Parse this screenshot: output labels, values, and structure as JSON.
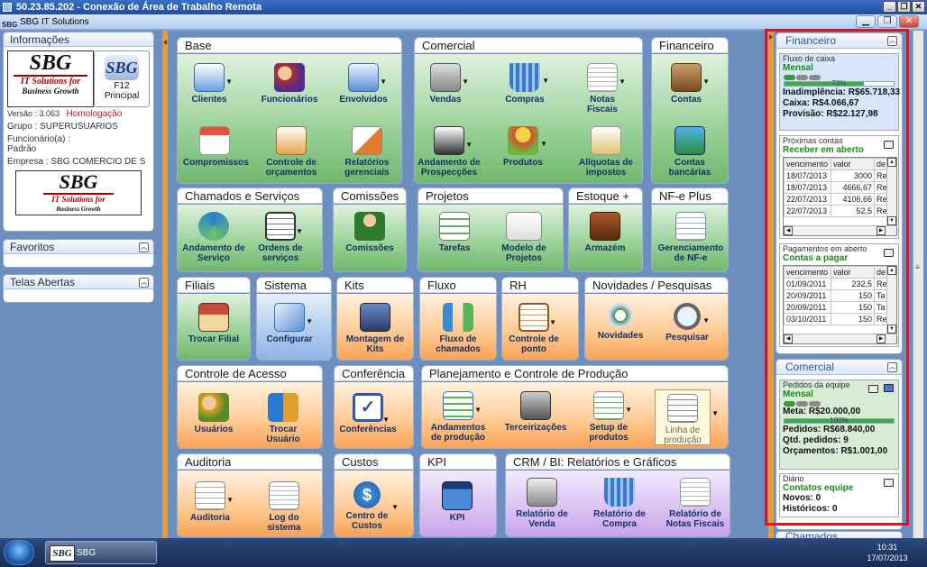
{
  "remote_title": "50.23.85.202 - Conexão de Área de Trabalho Remota",
  "app_title": "SBG IT Solutions",
  "app_logo_text": "SBG",
  "left": {
    "info_title": "Informações",
    "logo": {
      "big": "SBG",
      "sub1": "IT Solutions for",
      "sub2": "Business Growth"
    },
    "f12_label1": "F12",
    "f12_label2": "Principal",
    "versao": "Versão : 3.063",
    "ambiente": "Homologação",
    "grupo": "Grupo : SUPERUSUARIOS",
    "funcionario_label": "Funcionário(a) :",
    "funcionario": "Padrão",
    "empresa": "Empresa : SBG COMERCIO DE S",
    "favoritos": "Favoritos",
    "telas_abertas": "Telas Abertas"
  },
  "groups": {
    "base": {
      "title": "Base",
      "items": [
        "Clientes",
        "Funcionários",
        "Envolvidos",
        "Compromissos",
        "Controle de orçamentos",
        "Relatórios gerenciais"
      ]
    },
    "comercial": {
      "title": "Comercial",
      "items": [
        "Vendas",
        "Compras",
        "Notas Fiscais",
        "Andamento de Prospecções",
        "Produtos",
        "Alíquotas de impostos"
      ]
    },
    "financeiro": {
      "title": "Financeiro",
      "items": [
        "Contas",
        "Contas bancárias"
      ]
    },
    "chamados": {
      "title": "Chamados e Serviços",
      "items": [
        "Andamento de Serviço",
        "Ordens de serviços"
      ]
    },
    "comissoes": {
      "title": "Comissões",
      "items": [
        "Comissões"
      ]
    },
    "projetos": {
      "title": "Projetos",
      "items": [
        "Tarefas",
        "Modelo de Projetos"
      ]
    },
    "estoque": {
      "title": "Estoque +",
      "items": [
        "Armazém"
      ]
    },
    "nfe": {
      "title": "NF-e Plus",
      "items": [
        "Gerenciamento de NF-e"
      ]
    },
    "filiais": {
      "title": "Filiais",
      "items": [
        "Trocar Filial"
      ]
    },
    "sistema": {
      "title": "Sistema",
      "items": [
        "Configurar"
      ]
    },
    "kits": {
      "title": "Kits",
      "items": [
        "Montagem de Kits"
      ]
    },
    "fluxo": {
      "title": "Fluxo",
      "items": [
        "Fluxo de chamados"
      ]
    },
    "rh": {
      "title": "RH",
      "items": [
        "Controle de ponto"
      ]
    },
    "novidades": {
      "title": "Novidades  / Pesquisas",
      "items": [
        "Novidades",
        "Pesquisar"
      ]
    },
    "acesso": {
      "title": "Controle de Acesso",
      "items": [
        "Usuários",
        "Trocar Usuário"
      ]
    },
    "conferencia": {
      "title": "Conferência",
      "items": [
        "Conferências"
      ]
    },
    "planejamento": {
      "title": "Planejamento e Controle de Produção",
      "items": [
        "Andamentos de produção",
        "Terceirizações",
        "Setup de produtos",
        "Linha de produção"
      ]
    },
    "auditoria": {
      "title": "Auditoria",
      "items": [
        "Auditoria",
        "Log do sistema"
      ]
    },
    "custos": {
      "title": "Custos",
      "items": [
        "Centro de Custos"
      ]
    },
    "kpi": {
      "title": "KPI",
      "items": [
        "KPI"
      ]
    },
    "crm": {
      "title": "CRM / BI: Relatórios e Gráficos",
      "items": [
        "Relatório de Venda",
        "Relatório de Compra",
        "Relatório de Notas Fiscais"
      ]
    }
  },
  "right": {
    "financeiro_title": "Financeiro",
    "fluxo": {
      "caption": "Fluxo de caixa",
      "period": "Mensal",
      "progress_percent": 73,
      "progress_label": "73%",
      "inadimplencia": "Inadimplência: R$65.718,33",
      "caixa": "Caixa:  R$4.066,67",
      "provisao": "Provisão:  R$22.127,98"
    },
    "proximas": {
      "caption": "Próximas contas",
      "subtitle": "Receber em aberto",
      "columns": [
        "vencimento",
        "valor",
        "de"
      ],
      "rows": [
        [
          "18/07/2013",
          "3000",
          "Re"
        ],
        [
          "18/07/2013",
          "4666,67",
          "Re"
        ],
        [
          "22/07/2013",
          "4106,66",
          "Re"
        ],
        [
          "22/07/2013",
          "52,5",
          "Re"
        ]
      ]
    },
    "pagamentos": {
      "caption": "Pagamentos em aberto",
      "subtitle": "Contas a pagar",
      "columns": [
        "vencimento",
        "valor",
        "de"
      ],
      "rows": [
        [
          "01/09/2011",
          "232,5",
          "Re"
        ],
        [
          "20/09/2011",
          "150",
          "Ta"
        ],
        [
          "20/09/2011",
          "150",
          "Ta"
        ],
        [
          "03/10/2011",
          "150",
          "Re"
        ]
      ]
    },
    "comercial_title": "Comercial",
    "pedidos": {
      "caption": "Pedidos da equipe",
      "period": "Mensal",
      "meta": "Meta:  R$20.000,00",
      "progress_percent": 100,
      "progress_label": "100%",
      "pedidos": "Pedidos:  R$68.840,00",
      "qtd": "Qtd. pedidos:  9",
      "orcamentos": "Orçamentos:  R$1.001,00"
    },
    "diario": {
      "caption": "Diário",
      "subtitle": "Contatos equipe",
      "novos": "Novos: 0",
      "historicos": "Históricos: 0"
    },
    "chamados_title": "Chamados"
  },
  "taskbar": {
    "item": "SBG",
    "item_logo": "SBG",
    "time": "10:31",
    "date": "17/07/2013"
  },
  "colors": {
    "accent_red": "#e0141e",
    "splitter": "#e59a3f",
    "green_text": "#1b8a1b"
  }
}
